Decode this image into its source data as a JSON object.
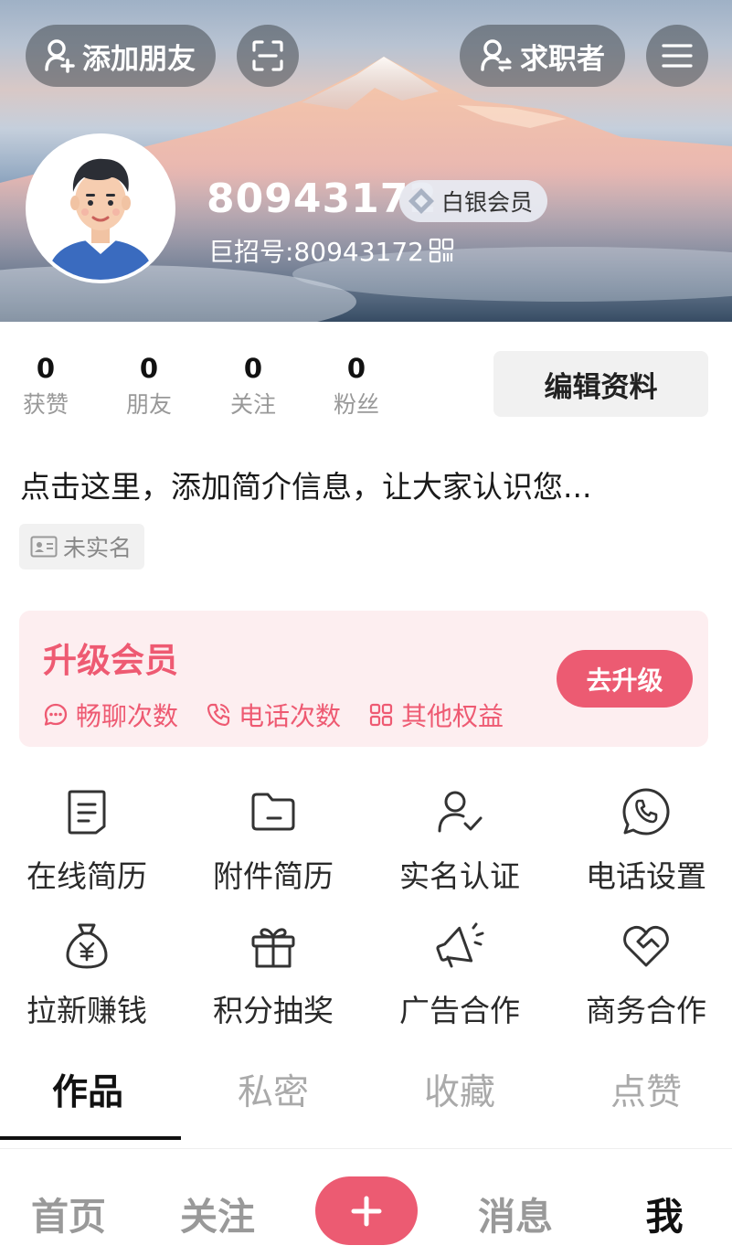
{
  "header": {
    "add_friend_label": "添加朋友",
    "jobseeker_label": "求职者",
    "username": "80943172",
    "member_level": "白银会员",
    "jz_id": "巨招号:80943172"
  },
  "stats": [
    {
      "value": "0",
      "label": "获赞"
    },
    {
      "value": "0",
      "label": "朋友"
    },
    {
      "value": "0",
      "label": "关注"
    },
    {
      "value": "0",
      "label": "粉丝"
    }
  ],
  "edit_profile_label": "编辑资料",
  "bio_placeholder": "点击这里，添加简介信息，让大家认识您...",
  "verification_status": "未实名",
  "vip": {
    "title": "升级会员",
    "perks": [
      "畅聊次数",
      "电话次数",
      "其他权益"
    ],
    "upgrade_label": "去升级"
  },
  "grid": [
    {
      "label": "在线简历",
      "icon": "resume-icon"
    },
    {
      "label": "附件简历",
      "icon": "folder-icon"
    },
    {
      "label": "实名认证",
      "icon": "user-check-icon"
    },
    {
      "label": "电话设置",
      "icon": "phone-icon"
    },
    {
      "label": "拉新赚钱",
      "icon": "money-bag-icon"
    },
    {
      "label": "积分抽奖",
      "icon": "gift-icon"
    },
    {
      "label": "广告合作",
      "icon": "megaphone-icon"
    },
    {
      "label": "商务合作",
      "icon": "handshake-icon"
    }
  ],
  "tabs": [
    "作品",
    "私密",
    "收藏",
    "点赞"
  ],
  "active_tab": "作品",
  "bottom_nav": [
    "首页",
    "关注",
    "消息",
    "我"
  ],
  "active_nav": "我",
  "colors": {
    "accent": "#ec5b72",
    "vip_background": "#fdeef0"
  }
}
